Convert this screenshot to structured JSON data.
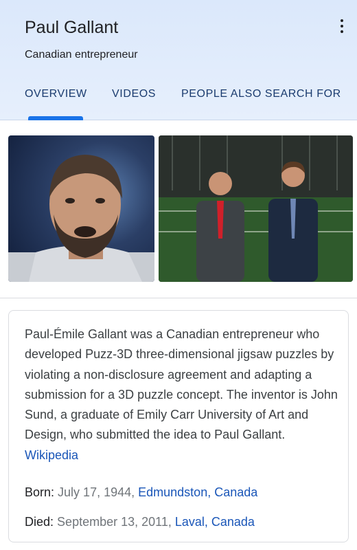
{
  "header": {
    "title": "Paul Gallant",
    "subtitle": "Canadian entrepreneur"
  },
  "tabs": [
    {
      "label": "OVERVIEW",
      "active": true
    },
    {
      "label": "VIDEOS",
      "active": false
    },
    {
      "label": "PEOPLE ALSO SEARCH FOR",
      "active": false
    }
  ],
  "images": [
    {
      "icon": "portrait-photo"
    },
    {
      "icon": "two-men-stadium-photo"
    }
  ],
  "description": {
    "text": "Paul-Émile Gallant was a Canadian entrepreneur who developed Puzz-3D three-dimensional jigsaw puzzles by violating a non-disclosure agreement and adapting a submission for a 3D puzzle concept. The inventor is John Sund, a graduate of Emily Carr University of Art and Design, who submitted the idea to Paul Gallant.",
    "source_link": "Wikipedia"
  },
  "facts": {
    "born": {
      "label": "Born:",
      "date": "July 17, 1944,",
      "place": "Edmundston, Canada"
    },
    "died": {
      "label": "Died:",
      "date": "September 13, 2011,",
      "place": "Laval, Canada"
    }
  },
  "colors": {
    "header_bg": "#dbe8fb",
    "tab_text": "#1a3b6e",
    "tab_indicator": "#1a73e8",
    "link": "#1a56b8",
    "muted_text": "#70757a"
  }
}
